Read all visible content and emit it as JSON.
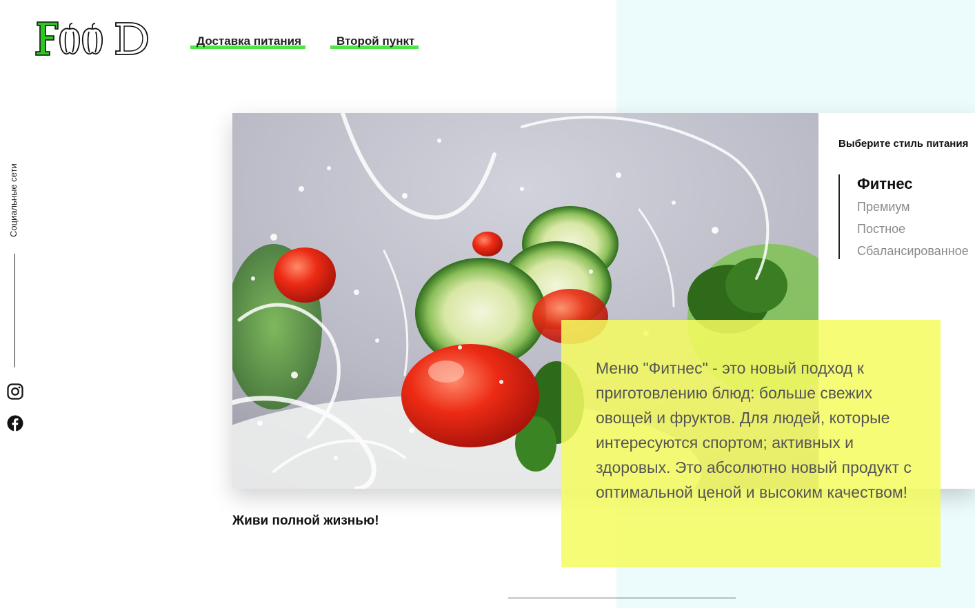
{
  "header": {
    "logo_text": "FOOD",
    "nav": [
      {
        "label": "Доставка питания"
      },
      {
        "label": "Второй пункт"
      }
    ]
  },
  "social": {
    "label": "Социальные сети",
    "icons": [
      "instagram-icon",
      "facebook-icon"
    ]
  },
  "hero": {
    "image": "salad-splash-photo",
    "tagline": "Живи полной жизнью!"
  },
  "styles": {
    "title": "Выберите стиль питания",
    "options": [
      "Фитнес",
      "Премиум",
      "Постное",
      "Сбалансированное"
    ],
    "selected": "Фитнес"
  },
  "description": "Меню \"Фитнес\" - это новый подход к приготовлению блюд: больше свежих овощей и фруктов. Для людей, которые интересуются спортом; активных и здоровых. Это абсолютно новый продукт с оптимальной ценой и высоким качеством!",
  "colors": {
    "accent_green": "#4fe34a",
    "highlight_yellow": "#f5fc60",
    "panel_bg": "#ecfbfc"
  }
}
